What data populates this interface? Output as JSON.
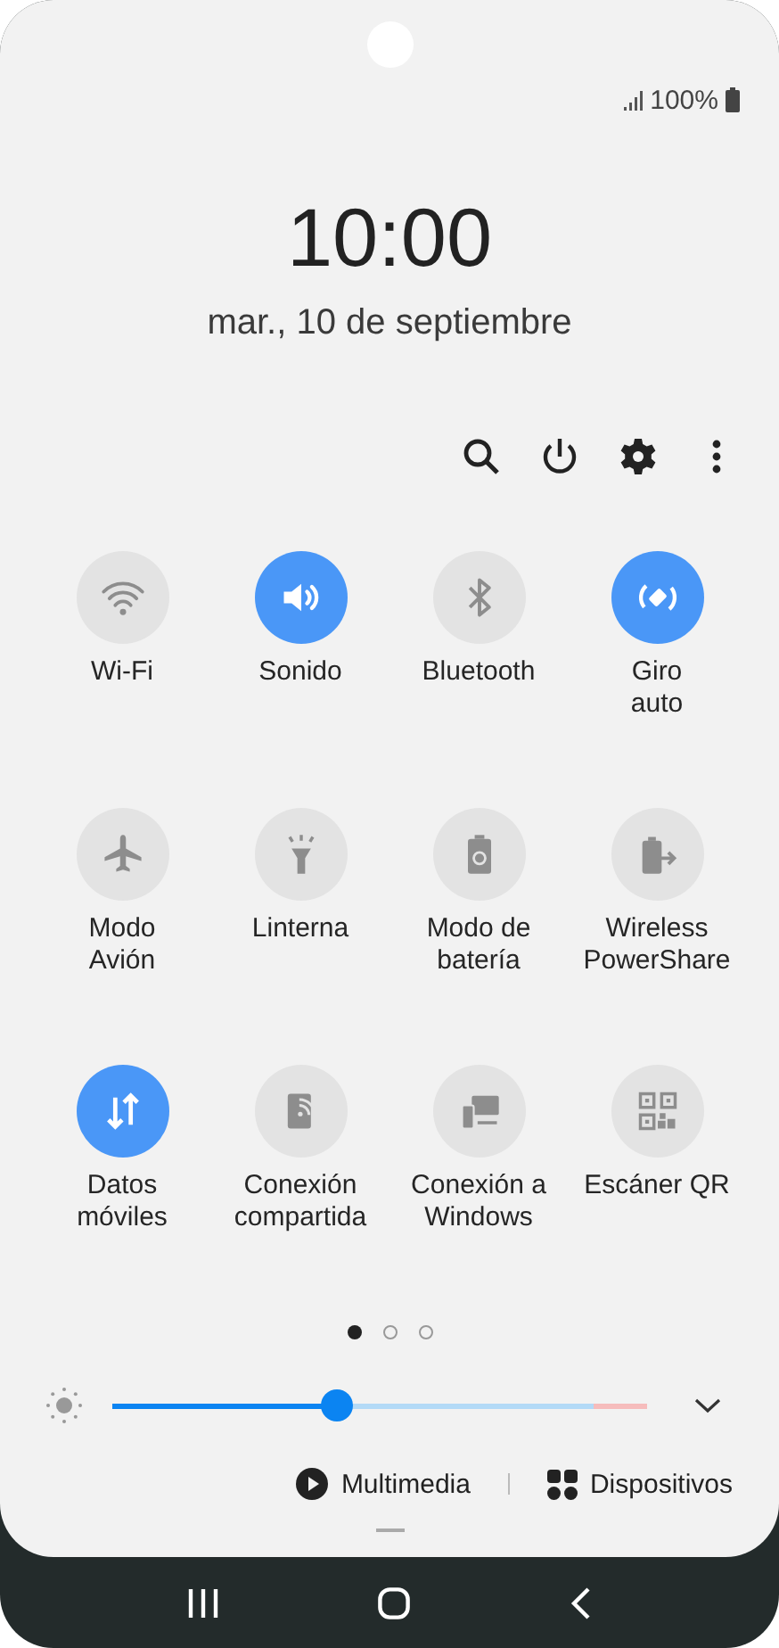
{
  "status": {
    "battery": "100%"
  },
  "clock": {
    "time": "10:00",
    "date": "mar., 10 de septiembre"
  },
  "tiles": [
    {
      "label": "Wi-Fi",
      "on": false
    },
    {
      "label": "Sonido",
      "on": true
    },
    {
      "label": "Bluetooth",
      "on": false
    },
    {
      "label": "Giro\nauto",
      "on": true
    },
    {
      "label": "Modo\nAvión",
      "on": false
    },
    {
      "label": "Linterna",
      "on": false
    },
    {
      "label": "Modo de\nbatería",
      "on": false
    },
    {
      "label": "Wireless\nPowerShare",
      "on": false
    },
    {
      "label": "Datos\nmóviles",
      "on": true
    },
    {
      "label": "Conexión\ncompartida",
      "on": false
    },
    {
      "label": "Conexión a\nWindows",
      "on": false
    },
    {
      "label": "Escáner QR",
      "on": false
    }
  ],
  "pager": [
    {
      "selected": true
    },
    {
      "selected": false
    },
    {
      "selected": false
    }
  ],
  "brightness": {
    "level": 0.42
  },
  "media_bar": {
    "multimedia": "Multimedia",
    "devices": "Dispositivos"
  }
}
